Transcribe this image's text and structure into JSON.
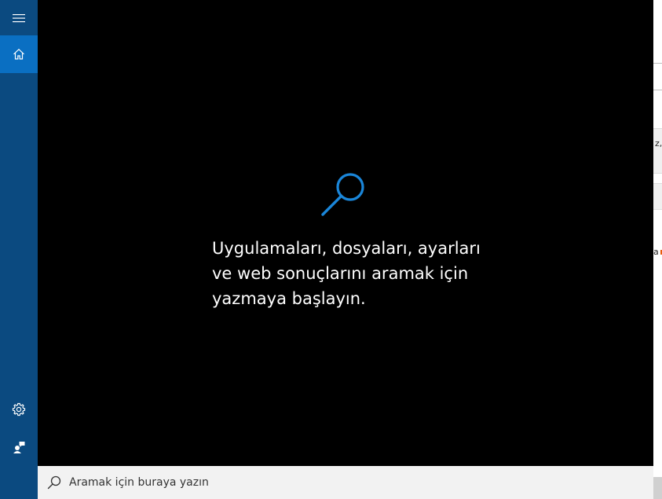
{
  "rail": {
    "menu_icon": "hamburger-menu-icon",
    "home_icon": "home-icon",
    "settings_icon": "gear-icon",
    "feedback_icon": "feedback-icon",
    "accent_color": "#0a6fc2",
    "background_color": "#0b4a80"
  },
  "panel": {
    "hint_icon": "search-icon",
    "hint_line1": "Uygulamaları, dosyaları, ayarları",
    "hint_line2": "ve web sonuçlarını aramak için",
    "hint_line3": "yazmaya başlayın.",
    "background_color": "#000000",
    "icon_color": "#1a86d9"
  },
  "search": {
    "placeholder": "Aramak için buraya yazın",
    "value": "",
    "icon": "search-icon"
  },
  "background_app": {
    "text1": "z,",
    "text2": "a"
  }
}
